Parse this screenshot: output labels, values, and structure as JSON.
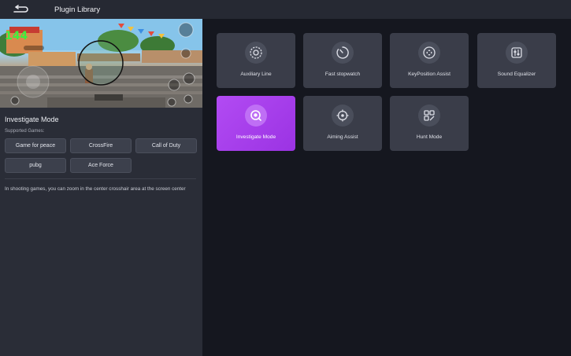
{
  "header": {
    "title": "Plugin Library",
    "back_icon": "back-arrow-icon"
  },
  "preview": {
    "hud_number": "144"
  },
  "detail": {
    "title": "Investigate Mode",
    "supported_label": "Supported Games:",
    "games": [
      "Game for peace",
      "CrossFire",
      "Call of Duty",
      "pubg",
      "Ace Force"
    ],
    "description": "In shooting games, you can zoom in the center crosshair area at the screen center"
  },
  "plugins": [
    {
      "label": "Auxiliary Line",
      "icon": "auxiliary-line-icon",
      "active": false
    },
    {
      "label": "Fast stopwatch",
      "icon": "stopwatch-icon",
      "active": false
    },
    {
      "label": "KeyPosition Assist",
      "icon": "key-position-icon",
      "active": false
    },
    {
      "label": "Sound Equalizer",
      "icon": "equalizer-icon",
      "active": false
    },
    {
      "label": "Investigate Mode",
      "icon": "zoom-search-icon",
      "active": true
    },
    {
      "label": "Aiming Assist",
      "icon": "crosshair-icon",
      "active": false
    },
    {
      "label": "Hunt Mode",
      "icon": "hunt-mode-icon",
      "active": false
    }
  ],
  "colors": {
    "accent": "#a93feb",
    "card": "#3a3d49",
    "panel": "#2a2d37",
    "background": "#15171f"
  }
}
